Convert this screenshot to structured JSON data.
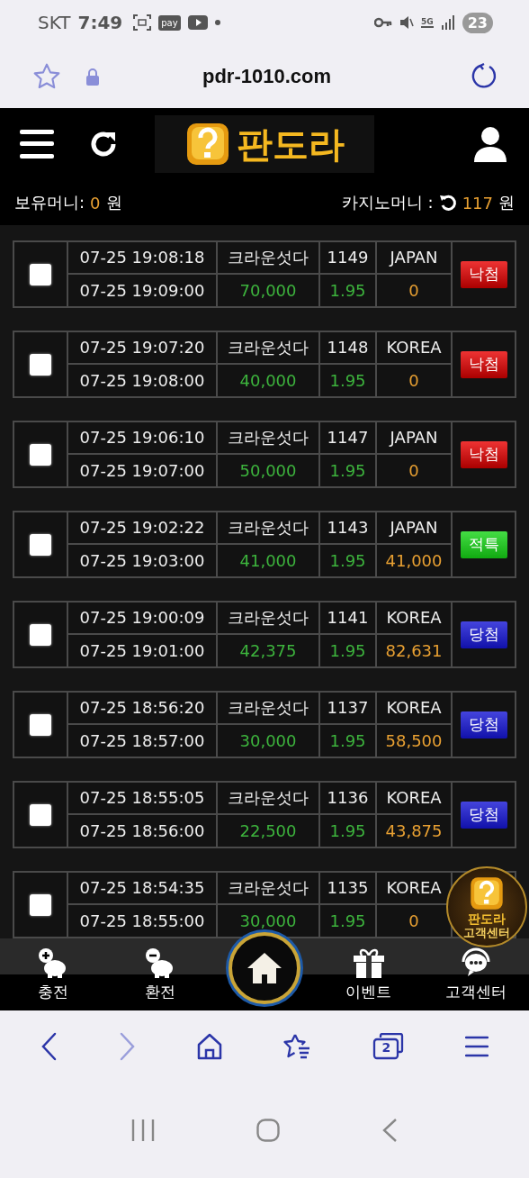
{
  "status_bar": {
    "carrier": "SKT",
    "time": "7:49",
    "pay_badge": "pay",
    "network": "5G",
    "battery": "23"
  },
  "address_bar": {
    "url": "pdr-1010.com"
  },
  "header": {
    "logo_text": "판도라",
    "held_money_label": "보유머니:",
    "held_money": "0",
    "held_unit": "원",
    "casino_money_label": "카지노머니 :",
    "casino_money": "117",
    "casino_unit": "원"
  },
  "bets": [
    {
      "checked": false,
      "placed": "07-25 19:08:18",
      "settled": "07-25 19:09:00",
      "game": "크라운섯다",
      "round": "1149",
      "amount": "70,000",
      "pick": "JAPAN",
      "odds": "1.95",
      "payout": "0",
      "status": {
        "kind": "lose",
        "label": "낙첨"
      }
    },
    {
      "checked": false,
      "placed": "07-25 19:07:20",
      "settled": "07-25 19:08:00",
      "game": "크라운섯다",
      "round": "1148",
      "amount": "40,000",
      "pick": "KOREA",
      "odds": "1.95",
      "payout": "0",
      "status": {
        "kind": "lose",
        "label": "낙첨"
      }
    },
    {
      "checked": false,
      "placed": "07-25 19:06:10",
      "settled": "07-25 19:07:00",
      "game": "크라운섯다",
      "round": "1147",
      "amount": "50,000",
      "pick": "JAPAN",
      "odds": "1.95",
      "payout": "0",
      "status": {
        "kind": "lose",
        "label": "낙첨"
      }
    },
    {
      "checked": false,
      "placed": "07-25 19:02:22",
      "settled": "07-25 19:03:00",
      "game": "크라운섯다",
      "round": "1143",
      "amount": "41,000",
      "pick": "JAPAN",
      "odds": "1.95",
      "payout": "41,000",
      "status": {
        "kind": "refund",
        "label": "적특"
      }
    },
    {
      "checked": false,
      "placed": "07-25 19:00:09",
      "settled": "07-25 19:01:00",
      "game": "크라운섯다",
      "round": "1141",
      "amount": "42,375",
      "pick": "KOREA",
      "odds": "1.95",
      "payout": "82,631",
      "status": {
        "kind": "win",
        "label": "당첨"
      }
    },
    {
      "checked": false,
      "placed": "07-25 18:56:20",
      "settled": "07-25 18:57:00",
      "game": "크라운섯다",
      "round": "1137",
      "amount": "30,000",
      "pick": "KOREA",
      "odds": "1.95",
      "payout": "58,500",
      "status": {
        "kind": "win",
        "label": "당첨"
      }
    },
    {
      "checked": false,
      "placed": "07-25 18:55:05",
      "settled": "07-25 18:56:00",
      "game": "크라운섯다",
      "round": "1136",
      "amount": "22,500",
      "pick": "KOREA",
      "odds": "1.95",
      "payout": "43,875",
      "status": {
        "kind": "win",
        "label": "당첨"
      }
    },
    {
      "checked": false,
      "placed": "07-25 18:54:35",
      "settled": "07-25 18:55:00",
      "game": "크라운섯다",
      "round": "1135",
      "amount": "30,000",
      "pick": "KOREA",
      "odds": "1.95",
      "payout": "0"
    }
  ],
  "floating_support": {
    "title": "판도라",
    "subtitle": "고객센터"
  },
  "bottom_nav": [
    {
      "kind": "charge",
      "label": "충전"
    },
    {
      "kind": "exchange",
      "label": "환전"
    },
    {
      "kind": "home"
    },
    {
      "kind": "event",
      "label": "이벤트"
    },
    {
      "kind": "support",
      "label": "고객센터"
    }
  ],
  "browser_toolbar": {
    "tab_count": "2"
  }
}
